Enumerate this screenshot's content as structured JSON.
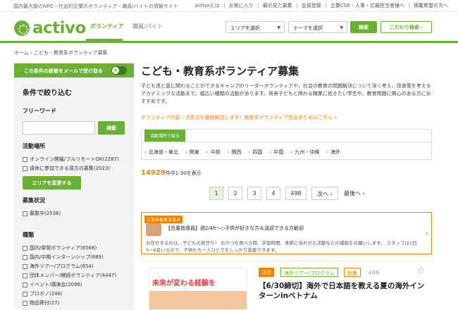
{
  "topbar": {
    "tagline": "国内最大級のNPO・社会的企業のボランティア・職員/バイトの情報サイト",
    "links": [
      "activoとは",
      "お気に入り",
      "最近見た募集",
      "会員登録",
      "企業CSR・人事・広報担当者様へ",
      "掲載希望の方へ"
    ]
  },
  "header": {
    "logo": "activo",
    "nav_volunteer": "ボランティア",
    "nav_job": "職員/バイト",
    "area_select": "エリアを選択",
    "theme_select": "テーマを選択",
    "search_btn": "検索",
    "kodawari_btn": "こだわり検索 ›"
  },
  "breadcrumb": "ホーム › こども・教育系ボランティア募集",
  "sidebar": {
    "mail_label": "この条件の新着をメールで受け取る",
    "toggle_label": "保",
    "title": "条件で絞り込む",
    "freeword_heading": "フリーワード",
    "freeword_btn": "検索",
    "location_heading": "活動場所",
    "location_opts": [
      "オンライン開催/フルリモートOK(2287)",
      "遠休に参加できる遠方の募集(2023)"
    ],
    "area_btn": "エリアを変更する",
    "status_heading": "募集状況",
    "status_opts": [
      "募集中(2536)"
    ],
    "type_heading": "種類",
    "type_opts": [
      "国内/単発ボランティア(6568)",
      "国内/中期インターンシップ(689)",
      "海外ツアー/プログラム(854)",
      "団体メンバー/継続ボランティア(4447)",
      "イベント/講演会(2096)",
      "プロボノ(246)",
      "物品寄付(27)"
    ]
  },
  "main": {
    "title": "こども・教育系ボランティア募集",
    "description": "子ども達と直に関わることができるキャンプのリーダーボランティアや、社会の教育の問題解決について深く考え、改善策を考えるアカデミックな活動まで、幅広い種類の活動があります。将来子どもと関わる職業に就きたい学生や、教育問題に関心のある方におすすめです。",
    "guide_link": "ボランティア内容・注意点を徹底解説します！教育系ボランティア完全まとめはこちら »",
    "area_tab": "活動場所で絞る",
    "areas": [
      "北海道・東北",
      "関東",
      "中部",
      "関西",
      "四国",
      "中国",
      "九州・沖縄",
      "海外"
    ],
    "count_num": "14929",
    "count_suffix": "件中1-30を表示",
    "pages": [
      "1",
      "2",
      "3",
      "4",
      "498",
      "次へ ›",
      "最後へ ›"
    ],
    "pickup": {
      "badge": "こちらもオススメ",
      "title": "【児童指導員】週2/4h〜◇子供が好きな方＆送迎できる方歓迎",
      "desc": "お任せするのは、子どもの見守り！ おやつを食べる時、学習時間、季節に合わせた活動などの補助をお願いします。 スタッフは1日5〜6名いるので、子供たち一人ひとりをしっかり支援できます。"
    },
    "card": {
      "image_text": "未来が変わる経験を",
      "badge_featured": "注目",
      "badge_category": "海外ツアー/プログラム",
      "badge_new": "新着",
      "days_ago": "4日前",
      "title": "【6/30締切】海外で日本語を教える夏の海外インターンinベトナム"
    }
  },
  "colors": {
    "brand_green": "#6ab035",
    "accent_orange": "#f08300"
  }
}
